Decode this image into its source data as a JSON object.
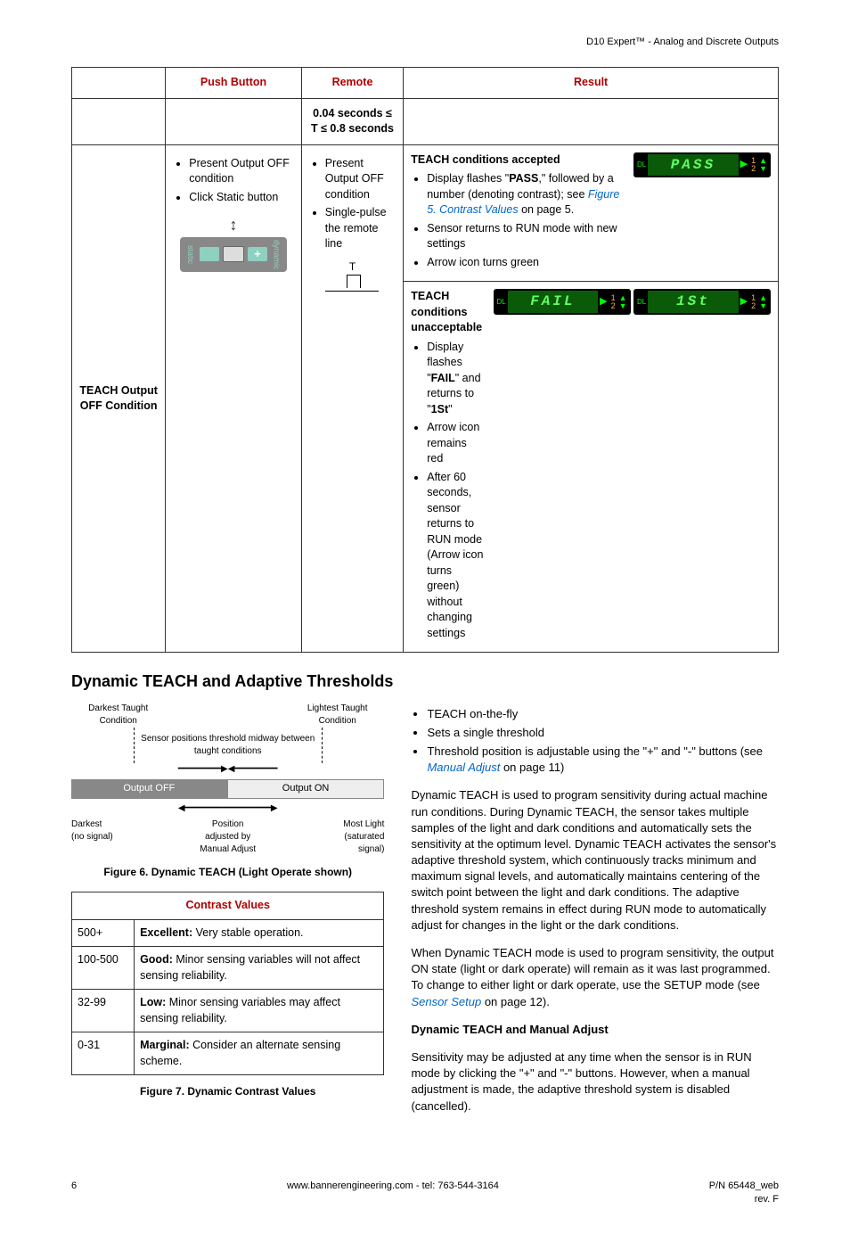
{
  "header": {
    "product": "D10 Expert™ - Analog and Discrete Outputs"
  },
  "table1": {
    "cols": {
      "c1": "Push Button",
      "c2": "Remote",
      "c3": "Result"
    },
    "subheader": "0.04 seconds ≤ T ≤ 0.8 seconds",
    "rowLabel": "TEACH Output OFF Condition",
    "push": {
      "b1": "Present Output OFF condition",
      "b2": "Click Static button",
      "btnLabels": {
        "left": "static",
        "right": "dynamic"
      }
    },
    "remote": {
      "b1": "Present Output OFF condition",
      "b2": "Single-pulse the remote line",
      "pulseLabel": "T"
    },
    "result1": {
      "title": "TEACH conditions accepted",
      "b1a": "Display flashes \"",
      "b1b": "PASS",
      "b1c": ",\" followed by a number (denoting contrast); see ",
      "link": "Figure 5. Contrast Values",
      "b1d": " on page 5.",
      "b2": "Sensor returns to RUN mode with new settings",
      "b3": "Arrow icon turns green",
      "lcd": "PASS"
    },
    "result2": {
      "title": "TEACH conditions unacceptable",
      "b1a": "Display flashes \"",
      "b1b": "FAIL",
      "b1c": "\" and returns to \"",
      "b1d": "1St",
      "b1e": "\"",
      "b2": "Arrow icon remains red",
      "b3": "After 60 seconds, sensor returns to RUN mode (Arrow icon turns green) without changing settings",
      "lcd1": "FAIL",
      "lcd2": "1St"
    }
  },
  "section2": {
    "heading": "Dynamic TEACH and Adaptive Thresholds",
    "diagram": {
      "darkestTaught": "Darkest Taught Condition",
      "lightestTaught": "Lightest Taught Condition",
      "midText": "Sensor positions threshold midway between taught conditions",
      "outputOff": "Output OFF",
      "outputOn": "Output ON",
      "bl1": "Darkest",
      "bl2": "(no signal)",
      "bm1": "Position",
      "bm2": "adjusted by",
      "bm3": "Manual Adjust",
      "br1": "Most Light",
      "br2": "(saturated",
      "br3": "signal)"
    },
    "fig6": "Figure 6. Dynamic TEACH (Light Operate shown)",
    "contrast": {
      "header": "Contrast Values",
      "r1": {
        "range": "500+",
        "lead": "Excellent:",
        "text": " Very stable operation."
      },
      "r2": {
        "range": "100-500",
        "lead": "Good:",
        "text": " Minor sensing variables will not affect sensing reliability."
      },
      "r3": {
        "range": "32-99",
        "lead": "Low:",
        "text": " Minor sensing variables may affect sensing reliability."
      },
      "r4": {
        "range": "0-31",
        "lead": "Marginal:",
        "text": " Consider an alternate sensing scheme."
      }
    },
    "fig7": "Figure 7. Dynamic Contrast Values",
    "right": {
      "b1": "TEACH on-the-fly",
      "b2": "Sets a single threshold",
      "b3a": "Threshold position is adjustable using the \"+\" and \"-\" buttons (see ",
      "b3link": "Manual Adjust",
      "b3b": " on page 11)",
      "p1": "Dynamic TEACH is used to program sensitivity during actual machine run conditions. During Dynamic TEACH, the sensor takes multiple samples of the light and dark conditions and automatically sets the sensitivity at the optimum level. Dynamic TEACH activates the sensor's adaptive threshold system, which continuously tracks minimum and maximum signal levels, and automatically maintains centering of the switch point between the light and dark conditions. The adaptive threshold system remains in effect during RUN mode to automatically adjust for changes in the light or the dark conditions.",
      "p2a": "When Dynamic TEACH mode is used to program sensitivity, the output ON state (light or dark operate) will remain as it was last programmed. To change to either light or dark operate, use the SETUP mode (see ",
      "p2link": "Sensor Setup",
      "p2b": " on page 12).",
      "sub": "Dynamic TEACH and Manual Adjust",
      "p3": "Sensitivity may be adjusted at any time when the sensor is in RUN mode by clicking the \"+\" and \"-\" buttons. However, when a manual adjustment is made, the adaptive threshold system is disabled (cancelled)."
    }
  },
  "footer": {
    "page": "6",
    "center": "www.bannerengineering.com - tel: 763-544-3164",
    "right1": "P/N 65448_web",
    "right2": "rev. F"
  }
}
